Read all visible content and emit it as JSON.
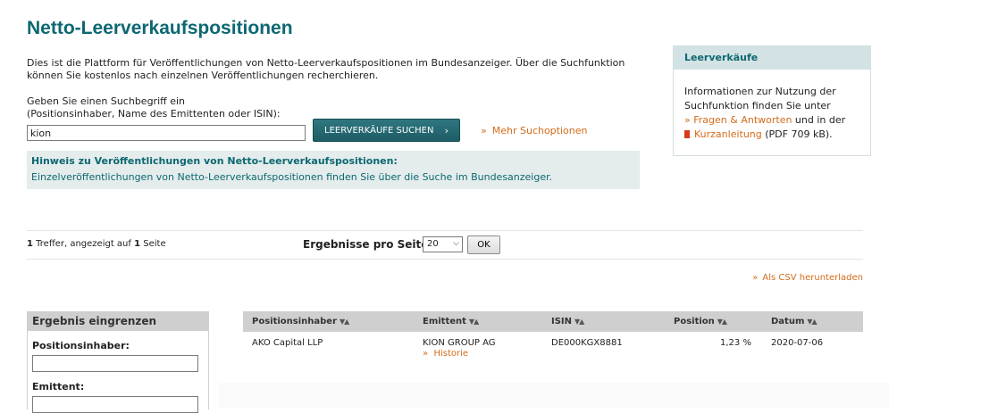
{
  "page": {
    "title": "Netto-Leerverkaufspositionen",
    "intro_line1": "Dies ist die Plattform für Veröffentlichungen von Netto-Leerverkaufspositionen im Bundesanzeiger. Über die Suchfunktion",
    "intro_line2": "können Sie kostenlos nach einzelnen Veröffentlichungen recherchieren."
  },
  "search": {
    "prompt_line1": "Geben Sie einen Suchbegriff ein",
    "prompt_line2": "(Positionsinhaber, Name des Emittenten oder ISIN):",
    "value": "kion",
    "button_label": "LEERVERKÄUFE SUCHEN",
    "more_options_label": "Mehr Suchoptionen"
  },
  "notice": {
    "title": "Hinweis zu Veröffentlichungen von Netto-Leerverkaufspositionen:",
    "text": "Einzelveröffentlichungen von Netto-Leerverkaufspositionen finden Sie über die Suche im Bundesanzeiger."
  },
  "sidebox": {
    "title": "Leerverkäufe",
    "line1": "Informationen zur Nutzung der",
    "line2": "Suchfunktion finden Sie unter",
    "faq_link": "Fragen & Antworten",
    "faq_suffix": " und in der",
    "guide_link": "Kurzanleitung",
    "guide_suffix": " (PDF 709 kB)."
  },
  "results_info": {
    "hits_count": "1",
    "hits_text": " Treffer, angezeigt auf ",
    "pages_count": "1",
    "pages_text": " Seite",
    "per_page_label": "Ergebnisse pro Seite:",
    "per_page_value": "20",
    "ok_label": "OK",
    "csv_label": "Als CSV herunterladen"
  },
  "filter": {
    "title": "Ergebnis eingrenzen",
    "holder_label": "Positionsinhaber:",
    "holder_value": "",
    "issuer_label": "Emittent:",
    "issuer_value": ""
  },
  "table": {
    "columns": [
      "Positionsinhaber",
      "Emittent",
      "ISIN",
      "Position",
      "Datum"
    ],
    "rows": [
      {
        "holder": "AKO Capital LLP",
        "issuer": "KION GROUP AG",
        "history_link": "Historie",
        "isin": "DE000KGX8881",
        "position": "1,23 %",
        "date": "2020-07-06"
      }
    ]
  },
  "colors": {
    "accent": "#0d6872",
    "link": "#d46c1a",
    "notice_bg": "#e4ecec"
  }
}
